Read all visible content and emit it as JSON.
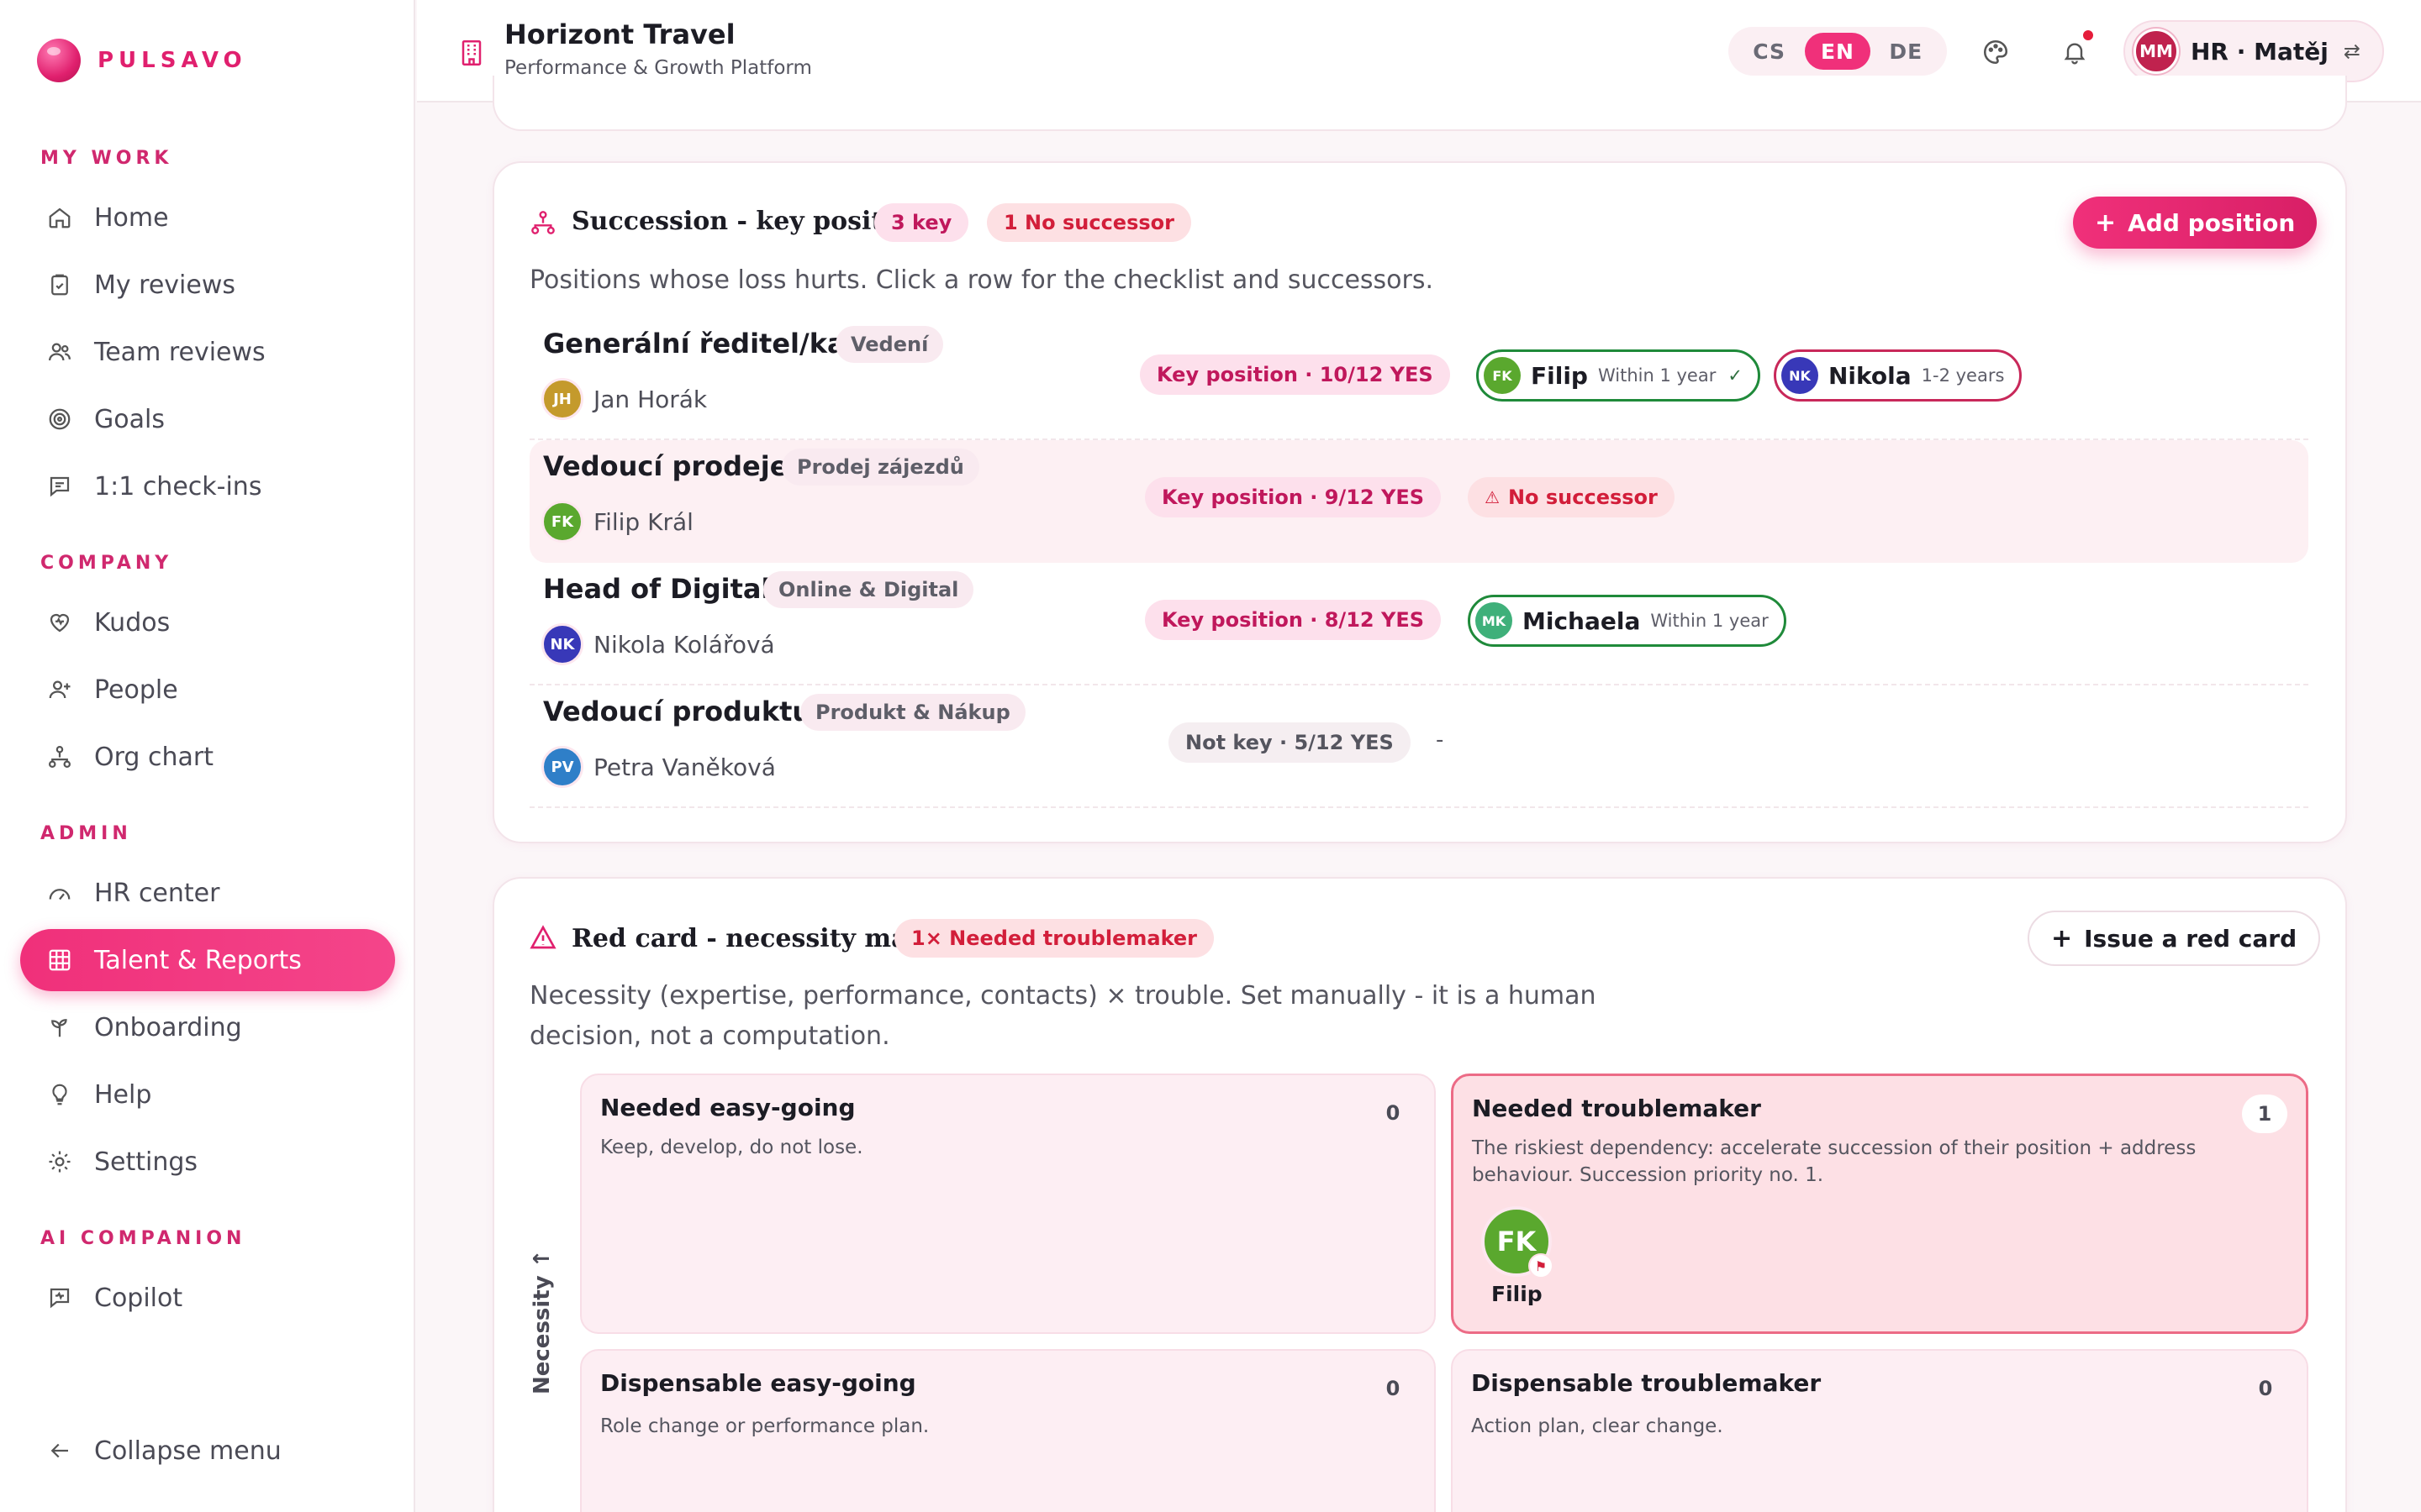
{
  "brand": {
    "name": "PULSAVO"
  },
  "sidebar": {
    "sections": [
      {
        "label": "MY WORK"
      },
      {
        "label": "COMPANY"
      },
      {
        "label": "ADMIN"
      },
      {
        "label": "AI COMPANION"
      }
    ],
    "items": [
      {
        "label": "Home",
        "icon": "home-icon"
      },
      {
        "label": "My reviews",
        "icon": "clipboard-check-icon"
      },
      {
        "label": "Team reviews",
        "icon": "users-icon"
      },
      {
        "label": "Goals",
        "icon": "target-icon"
      },
      {
        "label": "1:1 check-ins",
        "icon": "chat-icon"
      },
      {
        "label": "Kudos",
        "icon": "heart-icon"
      },
      {
        "label": "People",
        "icon": "user-plus-icon"
      },
      {
        "label": "Org chart",
        "icon": "org-chart-icon"
      },
      {
        "label": "HR center",
        "icon": "gauge-icon"
      },
      {
        "label": "Talent & Reports",
        "icon": "grid-icon",
        "active": true
      },
      {
        "label": "Onboarding",
        "icon": "sprout-icon"
      },
      {
        "label": "Help",
        "icon": "lightbulb-icon"
      },
      {
        "label": "Settings",
        "icon": "gear-icon"
      },
      {
        "label": "Copilot",
        "icon": "copilot-icon"
      }
    ],
    "collapse_label": "Collapse menu"
  },
  "topbar": {
    "org_title": "Horizont Travel",
    "org_subtitle": "Performance & Growth Platform",
    "languages": [
      "CS",
      "EN",
      "DE"
    ],
    "active_language": "EN",
    "user_initials": "MM",
    "user_label": "HR · Matěj"
  },
  "succession": {
    "title": "Succession - key positions",
    "badge_key": "3 key",
    "badge_no_successor": "1 No successor",
    "add_button": "Add position",
    "description": "Positions whose loss hurts. Click a row for the checklist and successors.",
    "rows": [
      {
        "title": "Generální ředitel/ka",
        "dept": "Vedení",
        "holder_initials": "JH",
        "holder_name": "Jan Horák",
        "holder_color": "#c49a2c",
        "key_label": "Key position · 10/12 YES",
        "successors": [
          {
            "initials": "FK",
            "name": "Filip",
            "time": "Within 1 year",
            "check": "✓",
            "color": "#5aa82e"
          },
          {
            "initials": "NK",
            "name": "Nikola",
            "time": "1-2 years",
            "check": "",
            "color": "#3838b8"
          }
        ]
      },
      {
        "title": "Vedoucí prodeje",
        "dept": "Prodej zájezdů",
        "holder_initials": "FK",
        "holder_name": "Filip Král",
        "holder_color": "#5aa82e",
        "key_label": "Key position · 9/12 YES",
        "no_successor": "No successor"
      },
      {
        "title": "Head of Digital",
        "dept": "Online & Digital",
        "holder_initials": "NK",
        "holder_name": "Nikola Kolářová",
        "holder_color": "#3838b8",
        "key_label": "Key position · 8/12 YES",
        "successors": [
          {
            "initials": "MK",
            "name": "Michaela",
            "time": "Within 1 year",
            "check": "",
            "color": "#3fb07a"
          }
        ]
      },
      {
        "title": "Vedoucí produktu",
        "dept": "Produkt & Nákup",
        "holder_initials": "PV",
        "holder_name": "Petra Vaněková",
        "holder_color": "#2f7fc8",
        "key_label": "Not key · 5/12 YES",
        "empty": "-"
      }
    ]
  },
  "redcard": {
    "title": "Red card - necessity matrix",
    "badge": "1× Needed troublemaker",
    "button": "Issue a red card",
    "description": "Necessity (expertise, performance, contacts) × trouble. Set manually - it is a human decision, not a computation.",
    "axis_label": "Necessity ↑",
    "quadrants": [
      {
        "title": "Needed easy-going",
        "desc": "Keep, develop, do not lose.",
        "count": "0"
      },
      {
        "title": "Needed troublemaker",
        "desc": "The riskiest dependency: accelerate succession of their position + address behaviour. Succession priority no. 1.",
        "count": "1"
      },
      {
        "title": "Dispensable easy-going",
        "desc": "Role change or performance plan.",
        "count": "0"
      },
      {
        "title": "Dispensable troublemaker",
        "desc": "Action plan, clear change.",
        "count": "0"
      }
    ],
    "person": {
      "initials": "FK",
      "name": "Filip"
    }
  }
}
